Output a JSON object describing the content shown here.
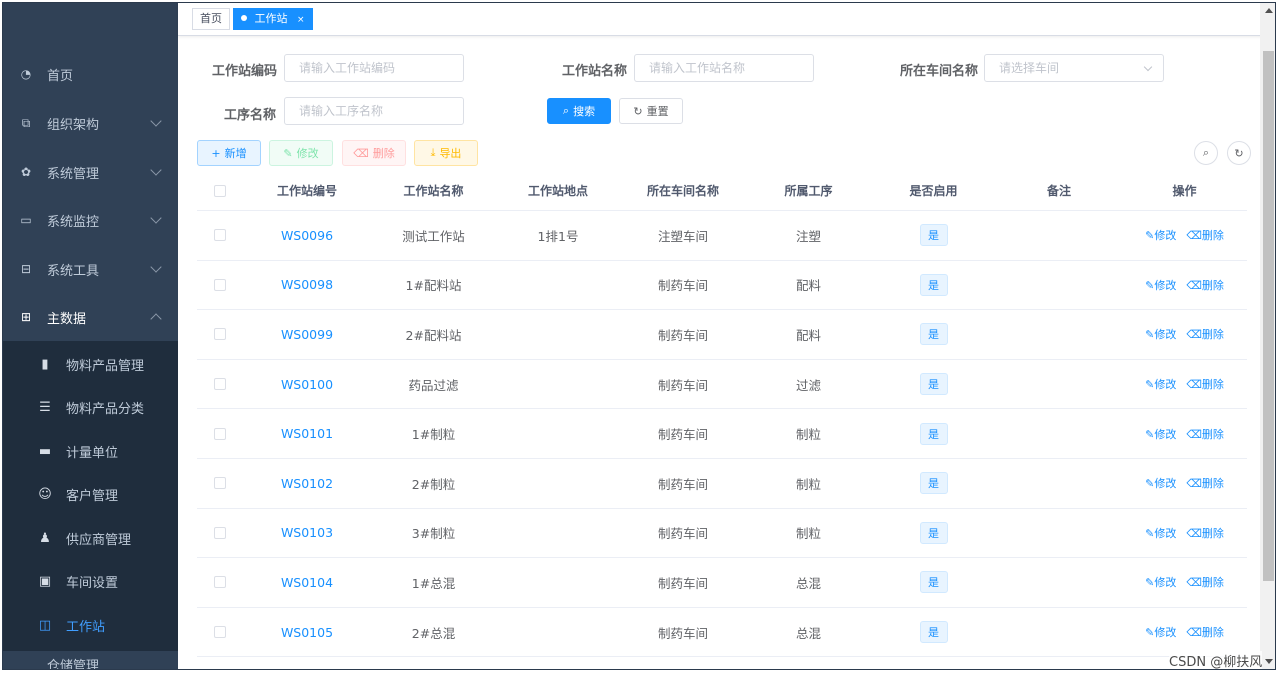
{
  "sidebar": {
    "items": [
      {
        "label": "首页",
        "icon": "dashboard-icon"
      },
      {
        "label": "组织架构",
        "icon": "org-tree-icon"
      },
      {
        "label": "系统管理",
        "icon": "gear-icon"
      },
      {
        "label": "系统监控",
        "icon": "monitor-icon"
      },
      {
        "label": "系统工具",
        "icon": "toolbox-icon"
      },
      {
        "label": "主数据",
        "icon": "grid-icon"
      }
    ],
    "submenu": [
      {
        "label": "物料产品管理",
        "icon": "book-icon"
      },
      {
        "label": "物料产品分类",
        "icon": "list-tree-icon"
      },
      {
        "label": "计量单位",
        "icon": "clapper-icon"
      },
      {
        "label": "客户管理",
        "icon": "customer-icon"
      },
      {
        "label": "供应商管理",
        "icon": "people-icon"
      },
      {
        "label": "车间设置",
        "icon": "workshop-icon"
      },
      {
        "label": "工作站",
        "icon": "station-icon"
      }
    ],
    "bottom_label": "仓储管理"
  },
  "tags": {
    "home": "首页",
    "current": "工作站",
    "close": "×"
  },
  "search": {
    "code_label": "工作站编码",
    "code_placeholder": "请输入工作站编码",
    "name_label": "工作站名称",
    "name_placeholder": "请输入工作站名称",
    "workshop_label": "所在车间名称",
    "workshop_placeholder": "请选择车间",
    "process_label": "工序名称",
    "process_placeholder": "请输入工序名称",
    "search_btn": "搜索",
    "reset_btn": "重置"
  },
  "toolbar": {
    "add": "新增",
    "edit": "修改",
    "delete": "删除",
    "export": "导出"
  },
  "table": {
    "headers": [
      "工作站编号",
      "工作站名称",
      "工作站地点",
      "所在车间名称",
      "所属工序",
      "是否启用",
      "备注",
      "操作"
    ],
    "rows": [
      {
        "code": "WS0096",
        "name": "测试工作站",
        "location": "1排1号",
        "workshop": "注塑车间",
        "process": "注塑",
        "enabled": "是",
        "remark": ""
      },
      {
        "code": "WS0098",
        "name": "1#配料站",
        "location": "",
        "workshop": "制药车间",
        "process": "配料",
        "enabled": "是",
        "remark": ""
      },
      {
        "code": "WS0099",
        "name": "2#配料站",
        "location": "",
        "workshop": "制药车间",
        "process": "配料",
        "enabled": "是",
        "remark": ""
      },
      {
        "code": "WS0100",
        "name": "药品过滤",
        "location": "",
        "workshop": "制药车间",
        "process": "过滤",
        "enabled": "是",
        "remark": ""
      },
      {
        "code": "WS0101",
        "name": "1#制粒",
        "location": "",
        "workshop": "制药车间",
        "process": "制粒",
        "enabled": "是",
        "remark": ""
      },
      {
        "code": "WS0102",
        "name": "2#制粒",
        "location": "",
        "workshop": "制药车间",
        "process": "制粒",
        "enabled": "是",
        "remark": ""
      },
      {
        "code": "WS0103",
        "name": "3#制粒",
        "location": "",
        "workshop": "制药车间",
        "process": "制粒",
        "enabled": "是",
        "remark": ""
      },
      {
        "code": "WS0104",
        "name": "1#总混",
        "location": "",
        "workshop": "制药车间",
        "process": "总混",
        "enabled": "是",
        "remark": ""
      },
      {
        "code": "WS0105",
        "name": "2#总混",
        "location": "",
        "workshop": "制药车间",
        "process": "总混",
        "enabled": "是",
        "remark": ""
      }
    ],
    "op_edit": "修改",
    "op_delete": "删除"
  },
  "watermark": "CSDN @柳扶风"
}
